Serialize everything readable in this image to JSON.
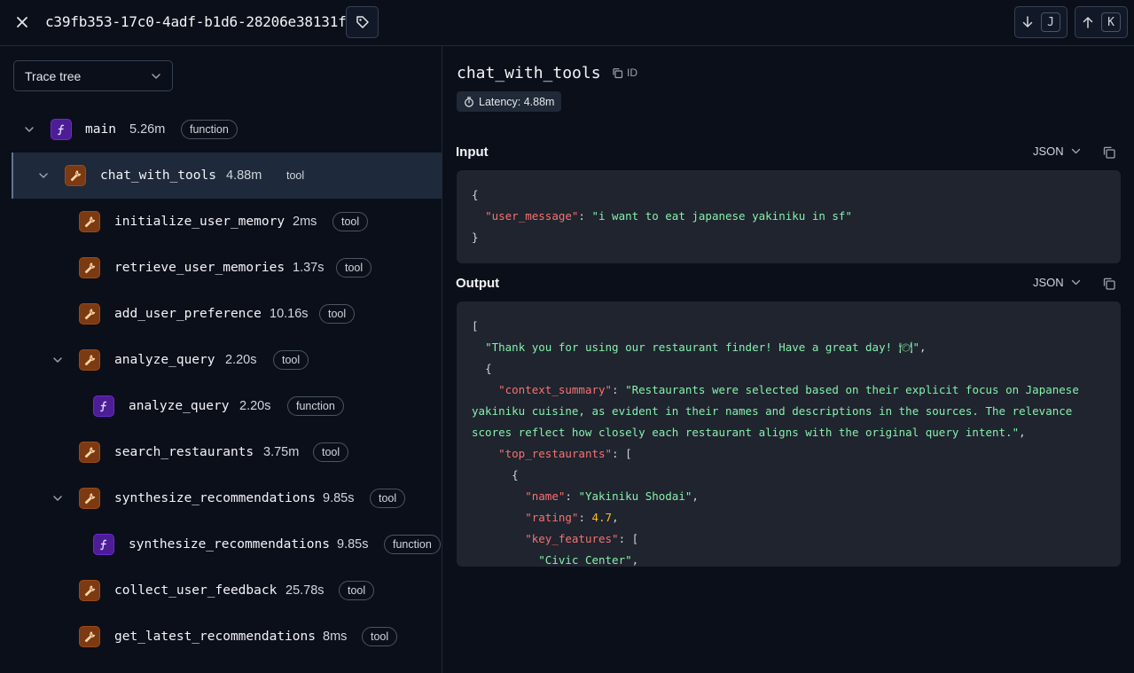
{
  "header": {
    "trace_id": "c39fb353-17c0-4adf-b1d6-28206e38131f",
    "nav_down_key": "J",
    "nav_up_key": "K"
  },
  "left": {
    "view_select": "Trace tree",
    "nodes": [
      {
        "name": "main",
        "duration": "5.26m",
        "type": "function"
      },
      {
        "name": "chat_with_tools",
        "duration": "4.88m",
        "type": "tool"
      },
      {
        "name": "initialize_user_memory",
        "duration": "2ms",
        "type": "tool"
      },
      {
        "name": "retrieve_user_memories",
        "duration": "1.37s",
        "type": "tool"
      },
      {
        "name": "add_user_preference",
        "duration": "10.16s",
        "type": "tool"
      },
      {
        "name": "analyze_query",
        "duration": "2.20s",
        "type": "tool"
      },
      {
        "name": "analyze_query",
        "duration": "2.20s",
        "type": "function"
      },
      {
        "name": "search_restaurants",
        "duration": "3.75m",
        "type": "tool"
      },
      {
        "name": "synthesize_recommendations",
        "duration": "9.85s",
        "type": "tool"
      },
      {
        "name": "synthesize_recommendations",
        "duration": "9.85s",
        "type": "function"
      },
      {
        "name": "collect_user_feedback",
        "duration": "25.78s",
        "type": "tool"
      },
      {
        "name": "get_latest_recommendations",
        "duration": "8ms",
        "type": "tool"
      }
    ]
  },
  "detail": {
    "title": "chat_with_tools",
    "id_label": "ID",
    "latency": "Latency: 4.88m",
    "input_label": "Input",
    "output_label": "Output",
    "format": "JSON",
    "input": {
      "open": "{",
      "key": "\"user_message\"",
      "value": "\"i want to eat japanese yakiniku in sf\"",
      "close": "}"
    },
    "output": {
      "bracket": "[",
      "thanks": "\"Thank you for using our restaurant finder! Have a great day! 🍽\"",
      "obj_open": "{",
      "ctx_key": "\"context_summary\"",
      "ctx_value": "\"Restaurants were selected based on their explicit focus on Japanese yakiniku cuisine, as evident in their names and descriptions in the sources. The relevance scores reflect how closely each restaurant aligns with the original query intent.\"",
      "top_key": "\"top_restaurants\"",
      "arr_open": "[",
      "item_open": "{",
      "name_key": "\"name\"",
      "name_value": "\"Yakiniku Shodai\"",
      "rating_key": "\"rating\"",
      "rating_value": "4.7",
      "features_key": "\"key_features\"",
      "features_open": "[",
      "feature_1": "\"Civic Center\""
    }
  }
}
